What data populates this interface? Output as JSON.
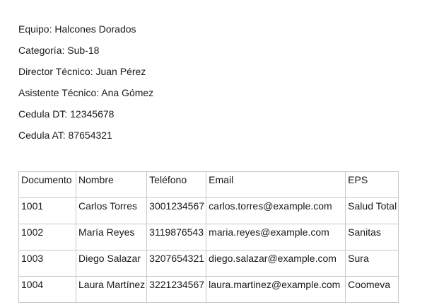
{
  "team_info": {
    "equipo": "Equipo: Halcones Dorados",
    "categoria": "Categoría: Sub-18",
    "director": "Director Técnico: Juan Pérez",
    "asistente": "Asistente Técnico: Ana Gómez",
    "cedula_dt": "Cedula DT: 12345678",
    "cedula_at": "Cedula AT: 87654321"
  },
  "table": {
    "headers": [
      "Documento",
      "Nombre",
      "Teléfono",
      "Email",
      "EPS"
    ],
    "rows": [
      [
        "1001",
        "Carlos Torres",
        "3001234567",
        "carlos.torres@example.com",
        "Salud Total"
      ],
      [
        "1002",
        "María Reyes",
        "3119876543",
        "maria.reyes@example.com",
        "Sanitas"
      ],
      [
        "1003",
        "Diego Salazar",
        "3207654321",
        "diego.salazar@example.com",
        "Sura"
      ],
      [
        "1004",
        "Laura Martínez",
        "3221234567",
        "laura.martinez@example.com",
        "Coomeva"
      ]
    ]
  }
}
